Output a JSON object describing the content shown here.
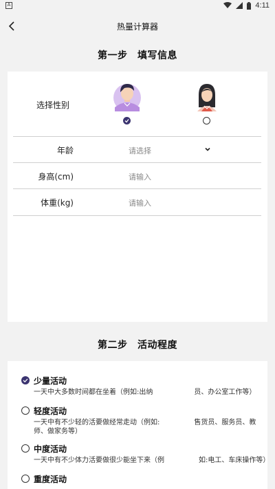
{
  "status": {
    "time": "4:11",
    "left_badge": "A"
  },
  "nav": {
    "title": "热量计算器"
  },
  "step1": {
    "title": "第一步　填写信息",
    "gender_label": "选择性别",
    "rows": [
      {
        "label": "年龄",
        "value": "请选择"
      },
      {
        "label": "身高(cm)",
        "value": "请输入"
      },
      {
        "label": "体重(kg)",
        "value": "请输入"
      }
    ]
  },
  "step2": {
    "title": "第二步　活动程度",
    "activities": [
      {
        "title": "少量活动",
        "desc": "一天中大多数时间都在坐着（例如:出纳　　　　　　员、办公室工作等）",
        "selected": true
      },
      {
        "title": "轻度活动",
        "desc": "一天中有不少轻的活要做经常走动（例如:　　　　　售货员、服务员、教师、做家务等）",
        "selected": false
      },
      {
        "title": "中度活动",
        "desc": "一天中有不少体力活要做很少能坐下来（例　　　　　如:电工、车床操作等）",
        "selected": false
      },
      {
        "title": "重度活动",
        "desc": "",
        "selected": false
      }
    ]
  },
  "colors": {
    "accent": "#3b3470",
    "background": "#f2f2f2",
    "card": "#ffffff"
  },
  "icons": [
    "back-arrow-icon",
    "male-avatar-icon",
    "female-avatar-icon",
    "chevron-down-icon",
    "wifi-icon",
    "signal-icon",
    "battery-icon"
  ]
}
